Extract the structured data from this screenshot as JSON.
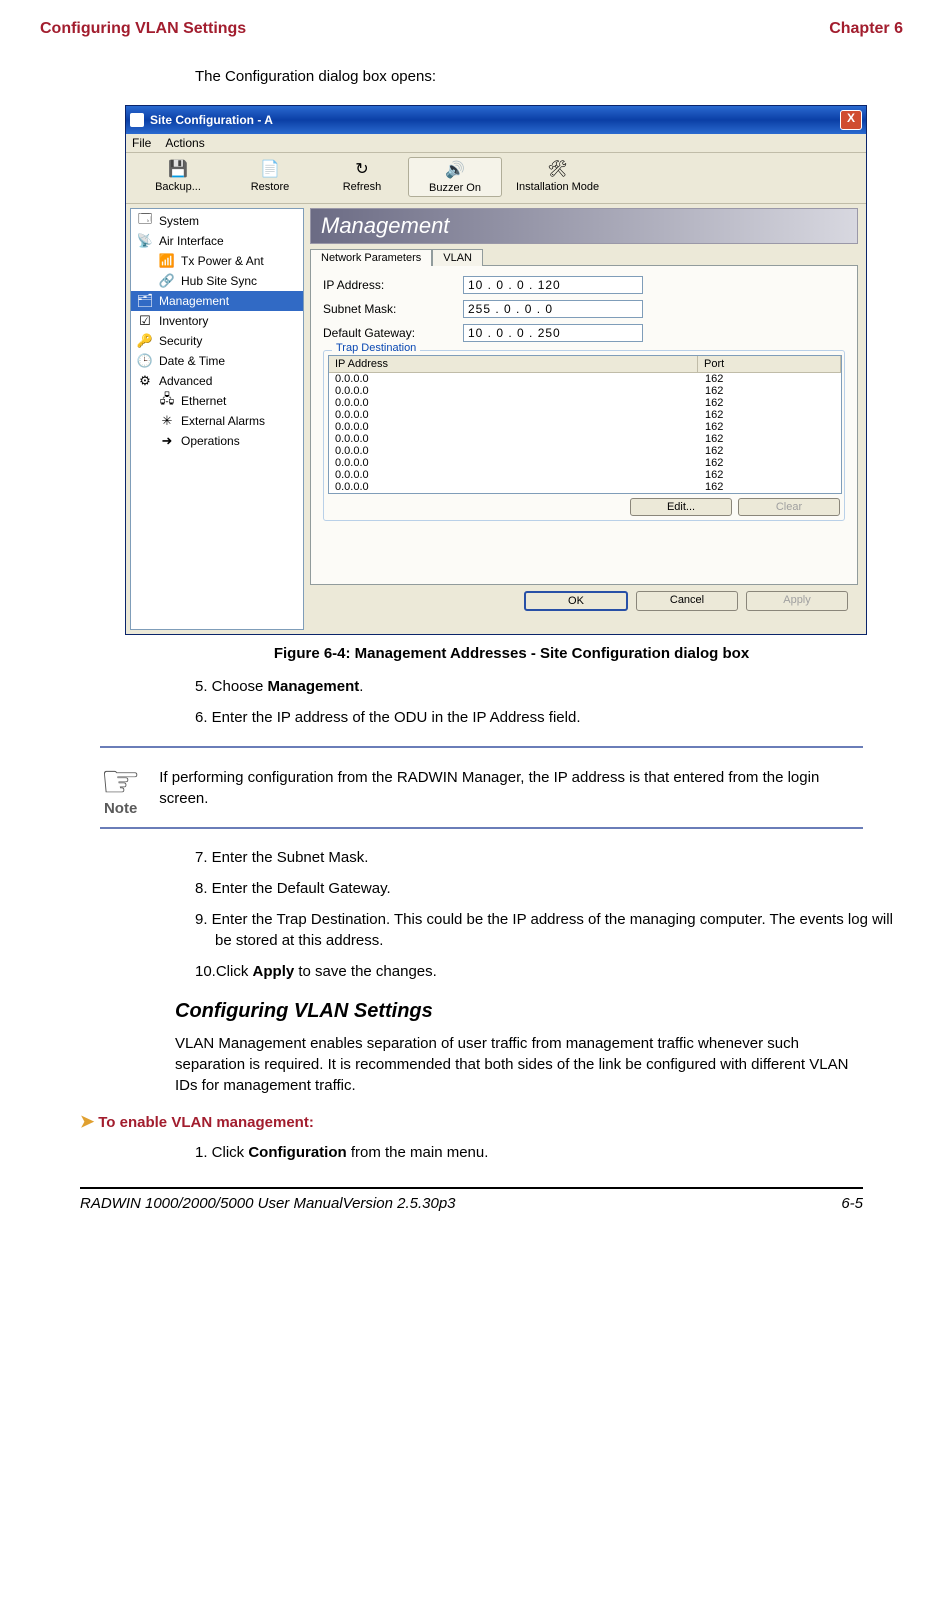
{
  "header": {
    "left": "Configuring VLAN Settings",
    "right": "Chapter 6"
  },
  "intro": "The Configuration dialog box opens:",
  "window": {
    "title": "Site Configuration - A",
    "close": "X",
    "menus": [
      "File",
      "Actions"
    ],
    "toolbar": [
      {
        "label": "Backup...",
        "icon": "💾"
      },
      {
        "label": "Restore",
        "icon": "📄"
      },
      {
        "label": "Refresh",
        "icon": "↻"
      },
      {
        "label": "Buzzer On",
        "icon": "🔊"
      },
      {
        "label": "Installation Mode",
        "icon": "🛠"
      }
    ],
    "sidebar": [
      {
        "label": "System",
        "icon": "🗔",
        "child": false
      },
      {
        "label": "Air Interface",
        "icon": "📡",
        "child": false
      },
      {
        "label": "Tx Power & Ant",
        "icon": "📶",
        "child": true
      },
      {
        "label": "Hub Site Sync",
        "icon": "🔗",
        "child": true
      },
      {
        "label": "Management",
        "icon": "🗂",
        "child": false,
        "selected": true
      },
      {
        "label": "Inventory",
        "icon": "☑",
        "child": false
      },
      {
        "label": "Security",
        "icon": "🔑",
        "child": false
      },
      {
        "label": "Date & Time",
        "icon": "🕒",
        "child": false
      },
      {
        "label": "Advanced",
        "icon": "⚙",
        "child": false
      },
      {
        "label": "Ethernet",
        "icon": "🖧",
        "child": true
      },
      {
        "label": "External Alarms",
        "icon": "✳",
        "child": true
      },
      {
        "label": "Operations",
        "icon": "➜",
        "child": true
      }
    ],
    "panel_title": "Management",
    "tabs": {
      "active": "Network Parameters",
      "other": "VLAN"
    },
    "fields": {
      "ip_label": "IP Address:",
      "ip_value": "10  .  0  .  0  . 120",
      "subnet_label": "Subnet Mask:",
      "subnet_value": "255 .  0  .  0  .   0",
      "gw_label": "Default Gateway:",
      "gw_value": "10  .  0  .  0  . 250"
    },
    "trap": {
      "group_title": "Trap Destination",
      "head_ip": "IP Address",
      "head_port": "Port",
      "rows": [
        {
          "ip": "0.0.0.0",
          "port": "162"
        },
        {
          "ip": "0.0.0.0",
          "port": "162"
        },
        {
          "ip": "0.0.0.0",
          "port": "162"
        },
        {
          "ip": "0.0.0.0",
          "port": "162"
        },
        {
          "ip": "0.0.0.0",
          "port": "162"
        },
        {
          "ip": "0.0.0.0",
          "port": "162"
        },
        {
          "ip": "0.0.0.0",
          "port": "162"
        },
        {
          "ip": "0.0.0.0",
          "port": "162"
        },
        {
          "ip": "0.0.0.0",
          "port": "162"
        },
        {
          "ip": "0.0.0.0",
          "port": "162"
        }
      ],
      "edit_btn": "Edit...",
      "clear_btn": "Clear"
    },
    "dlg_buttons": {
      "ok": "OK",
      "cancel": "Cancel",
      "apply": "Apply"
    }
  },
  "figure_caption": "Figure 6-4: Management Addresses - Site Configuration dialog box",
  "steps_a": {
    "s5_pre": "5. Choose ",
    "s5_bold": "Management",
    "s5_post": ".",
    "s6": "6. Enter the IP address of the ODU in the IP Address field."
  },
  "note": {
    "label": "Note",
    "text": "If performing configuration from the RADWIN Manager, the IP address is that entered from the login screen."
  },
  "steps_b": {
    "s7": "7. Enter the Subnet Mask.",
    "s8": "8. Enter the Default Gateway.",
    "s9": "9. Enter the Trap Destination. This could be the IP address of the managing computer. The events log will be stored at this address.",
    "s10_pre": "10.Click ",
    "s10_bold": "Apply",
    "s10_post": " to save the changes."
  },
  "section": {
    "heading": "Configuring VLAN Settings",
    "para": "VLAN Management enables separation of user traffic from management traffic whenever such separation is required. It is recommended that both sides of the link be configured with different VLAN IDs for management traffic."
  },
  "procedure": {
    "heading": "To enable VLAN management:",
    "s1_pre": "1. Click ",
    "s1_bold": "Configuration",
    "s1_post": " from the main menu."
  },
  "footer": {
    "left": "RADWIN 1000/2000/5000 User ManualVersion  2.5.30p3",
    "right": "6-5"
  }
}
